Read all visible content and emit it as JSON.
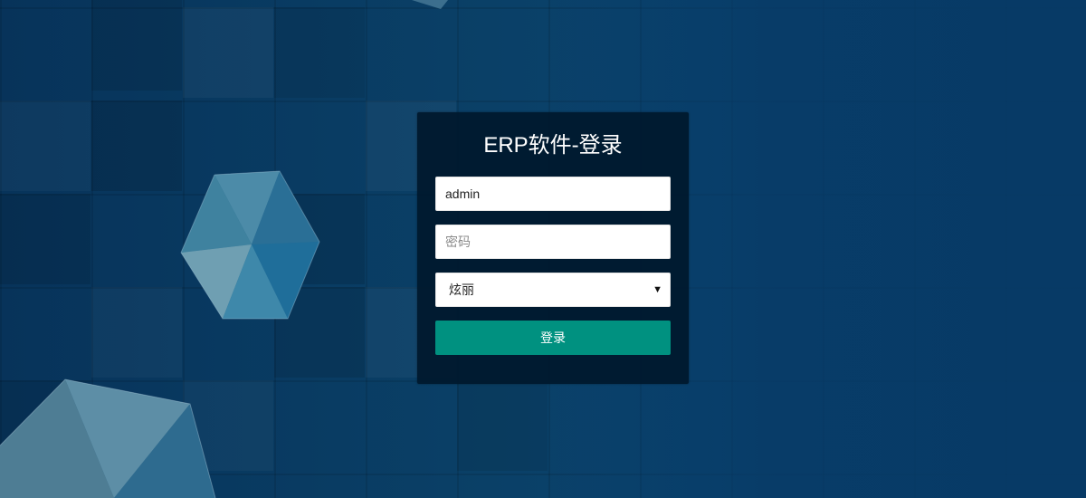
{
  "login": {
    "title": "ERP软件-登录",
    "username_value": "admin",
    "password_placeholder": "密码",
    "theme_selected": "炫丽",
    "submit_label": "登录"
  },
  "colors": {
    "panel_background": "#00182c",
    "submit_button": "#009180",
    "page_background": "#0a4067"
  }
}
